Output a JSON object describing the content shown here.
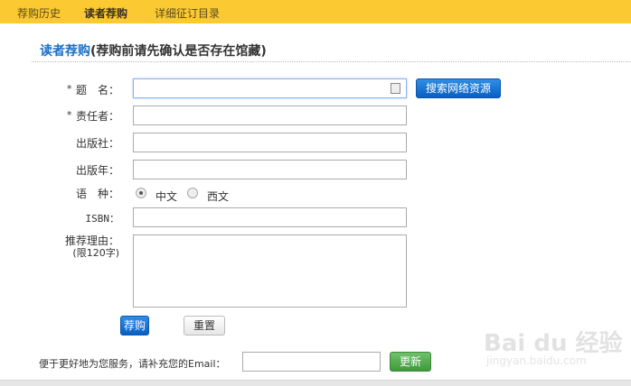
{
  "nav": {
    "tabs": [
      {
        "label": "荐购历史"
      },
      {
        "label": "读者荐购"
      },
      {
        "label": "详细征订目录"
      }
    ]
  },
  "heading": {
    "title": "读者荐购",
    "subtitle": "(荐购前请先确认是否存在馆藏)"
  },
  "form": {
    "required_mark": "*",
    "title_label": "题　名：",
    "author_label": "责任者：",
    "publisher_label": "出版社：",
    "year_label": "出版年：",
    "language_label": "语　种：",
    "language_options": [
      {
        "label": "中文",
        "selected": true
      },
      {
        "label": "西文",
        "selected": false
      }
    ],
    "isbn_label": "ISBN：",
    "reason_label": "推荐理由：",
    "reason_limit": "(限120字)",
    "search_button": "搜索网络资源",
    "submit_button": "荐购",
    "reset_button": "重置"
  },
  "email": {
    "label": "便于更好地为您服务，请补充您的Email：",
    "value": "",
    "update_button": "更新"
  },
  "watermark": {
    "brand": "Baidu经验",
    "url": "jingyan.baidu.com"
  }
}
